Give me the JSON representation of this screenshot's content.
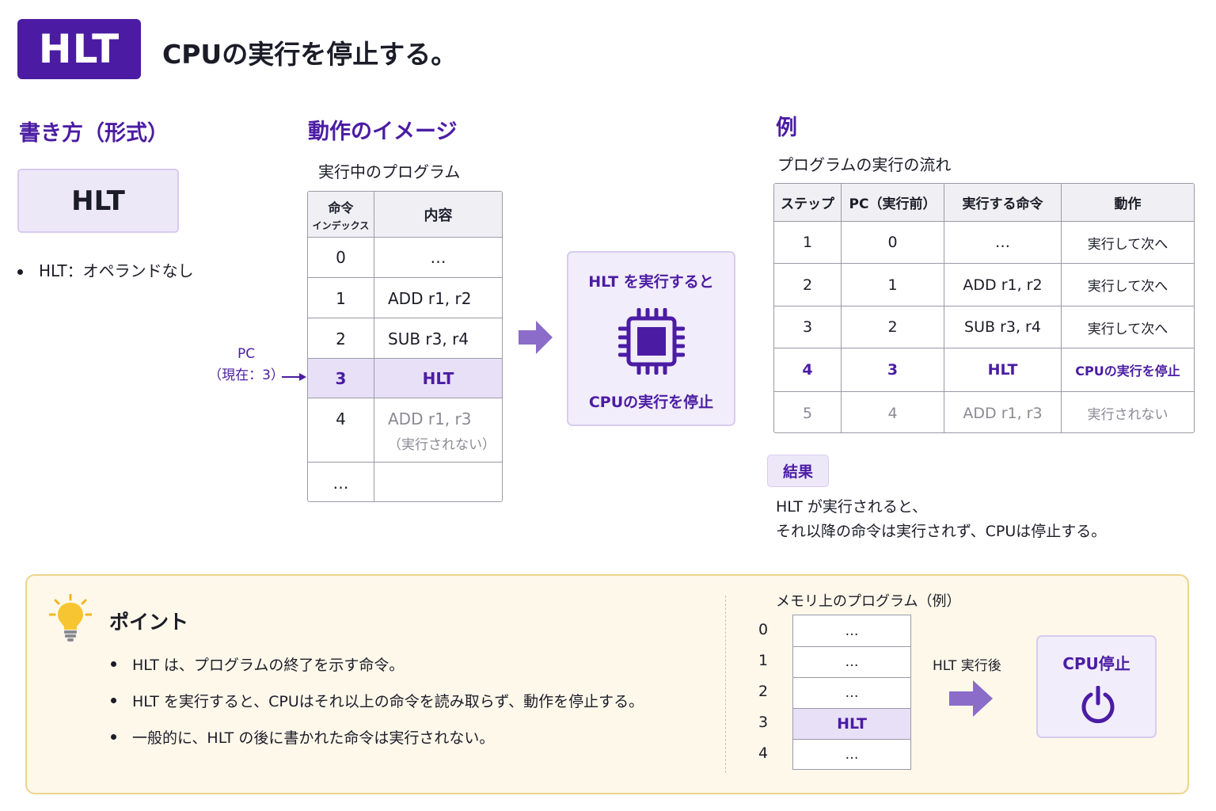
{
  "header": {
    "badge": "HLT",
    "title": "CPUの実行を停止する。"
  },
  "syntax": {
    "section_title": "書き方（形式）",
    "code": "HLT",
    "note": "HLT：オペランドなし"
  },
  "behavior": {
    "section_title": "動作のイメージ",
    "table_caption": "実行中のプログラム",
    "col_index_line1": "命令",
    "col_index_line2": "インデックス",
    "col_content": "内容",
    "rows": [
      {
        "index": "0",
        "content": "…",
        "note": ""
      },
      {
        "index": "1",
        "content": "ADD r1, r2",
        "note": ""
      },
      {
        "index": "2",
        "content": "SUB r3, r4",
        "note": ""
      },
      {
        "index": "3",
        "content": "HLT",
        "note": ""
      },
      {
        "index": "4",
        "content": "ADD r1, r3",
        "note": "（実行されない）"
      },
      {
        "index": "…",
        "content": "",
        "note": ""
      }
    ],
    "pc_label": "PC",
    "pc_current": "（現在：3）",
    "cpu_box_top": "HLT を実行すると",
    "cpu_box_bottom": "CPUの実行を停止"
  },
  "example": {
    "section_title": "例",
    "caption": "プログラムの実行の流れ",
    "headers": [
      "ステップ",
      "PC（実行前）",
      "実行する命令",
      "動作"
    ],
    "rows": [
      [
        "1",
        "0",
        "…",
        "実行して次へ"
      ],
      [
        "2",
        "1",
        "ADD r1, r2",
        "実行して次へ"
      ],
      [
        "3",
        "2",
        "SUB r3, r4",
        "実行して次へ"
      ],
      [
        "4",
        "3",
        "HLT",
        "CPUの実行を停止"
      ],
      [
        "5",
        "4",
        "ADD r1, r3",
        "実行されない"
      ]
    ],
    "result_badge": "結果",
    "result_line1": "HLT が実行されると、",
    "result_line2": "それ以降の命令は実行されず、CPUは停止する。"
  },
  "point": {
    "title": "ポイント",
    "items": [
      "HLT は、プログラムの終了を示す命令。",
      "HLT を実行すると、CPUはそれ以上の命令を読み取らず、動作を停止する。",
      "一般的に、HLT の後に書かれた命令は実行されない。"
    ],
    "memory_label": "メモリ上のプログラム（例）",
    "memory_rows": [
      {
        "index": "0",
        "content": "…"
      },
      {
        "index": "1",
        "content": "…"
      },
      {
        "index": "2",
        "content": "…"
      },
      {
        "index": "3",
        "content": "HLT"
      },
      {
        "index": "4",
        "content": "…"
      }
    ],
    "after_label": "HLT 実行後",
    "stop_label": "CPU停止"
  },
  "colors": {
    "accent": "#4b1ca3",
    "highlight": "#e8e0f7",
    "panel": "#fdf8ea",
    "arrow": "#8b6cc9"
  },
  "icons": {
    "cpu": "cpu-chip-icon",
    "power": "power-icon",
    "bulb": "lightbulb-icon"
  }
}
